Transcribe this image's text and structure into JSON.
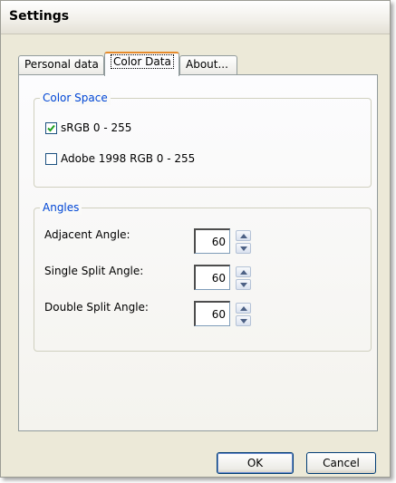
{
  "window": {
    "title": "Settings"
  },
  "tabs": [
    {
      "label": "Personal data",
      "active": false
    },
    {
      "label": "Color Data",
      "active": true
    },
    {
      "label": "About...",
      "active": false
    }
  ],
  "color_space": {
    "legend": "Color Space",
    "options": [
      {
        "label": "sRGB 0 - 255",
        "checked": true
      },
      {
        "label": "Adobe 1998 RGB 0 - 255",
        "checked": false
      }
    ]
  },
  "angles": {
    "legend": "Angles",
    "rows": [
      {
        "label": "Adjacent Angle:",
        "value": "60"
      },
      {
        "label": "Single Split Angle:",
        "value": "60"
      },
      {
        "label": "Double Split Angle:",
        "value": "60"
      }
    ]
  },
  "buttons": {
    "ok": "OK",
    "cancel": "Cancel"
  },
  "colors": {
    "accent_tab": "#e68b2c",
    "group_label": "#0046d5",
    "check_green": "#21a121"
  }
}
